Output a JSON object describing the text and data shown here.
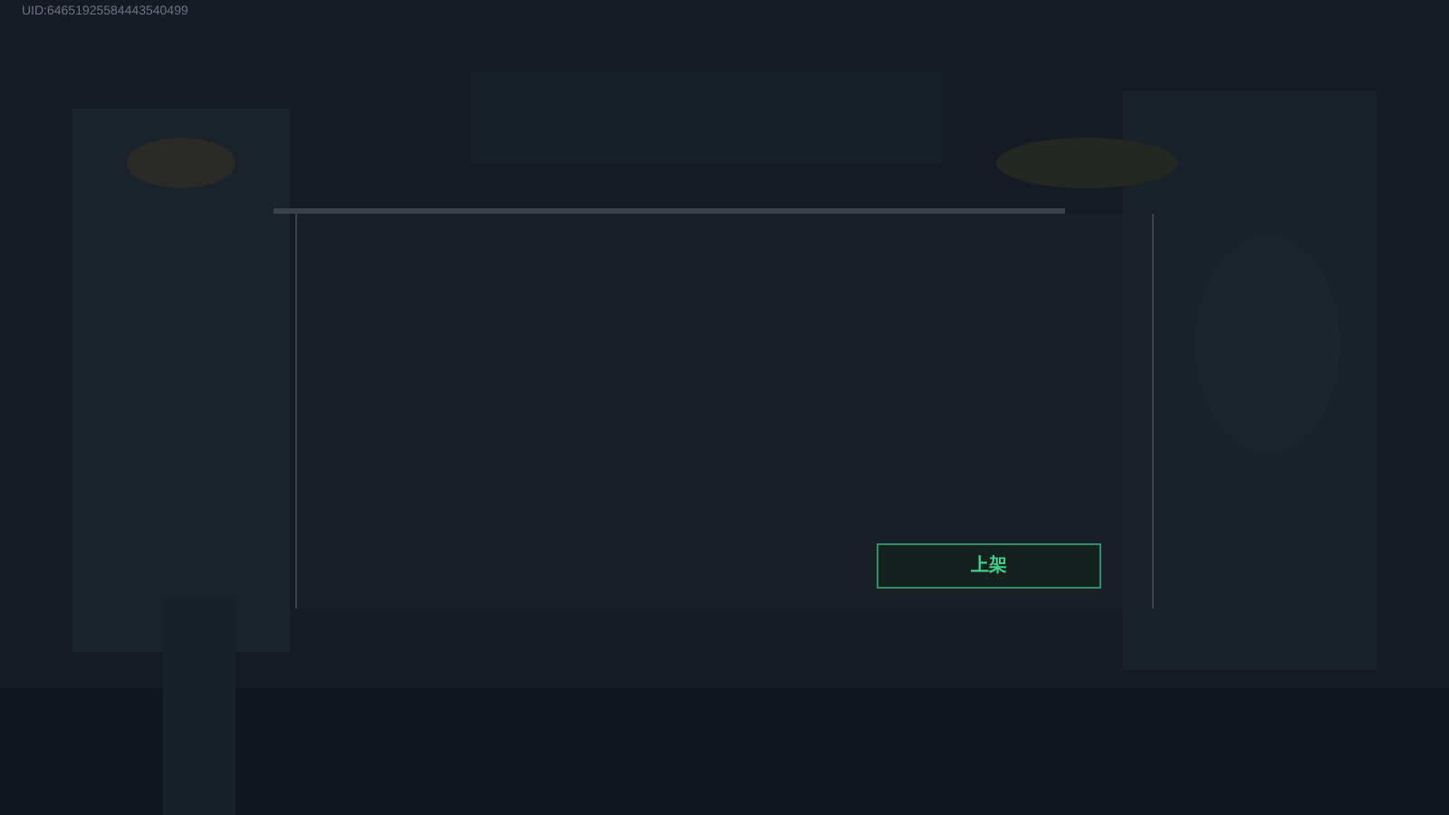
{
  "uid_label": "UID:64651925584443540499",
  "dialog": {
    "confirm_button": {
      "label": "上架"
    }
  }
}
